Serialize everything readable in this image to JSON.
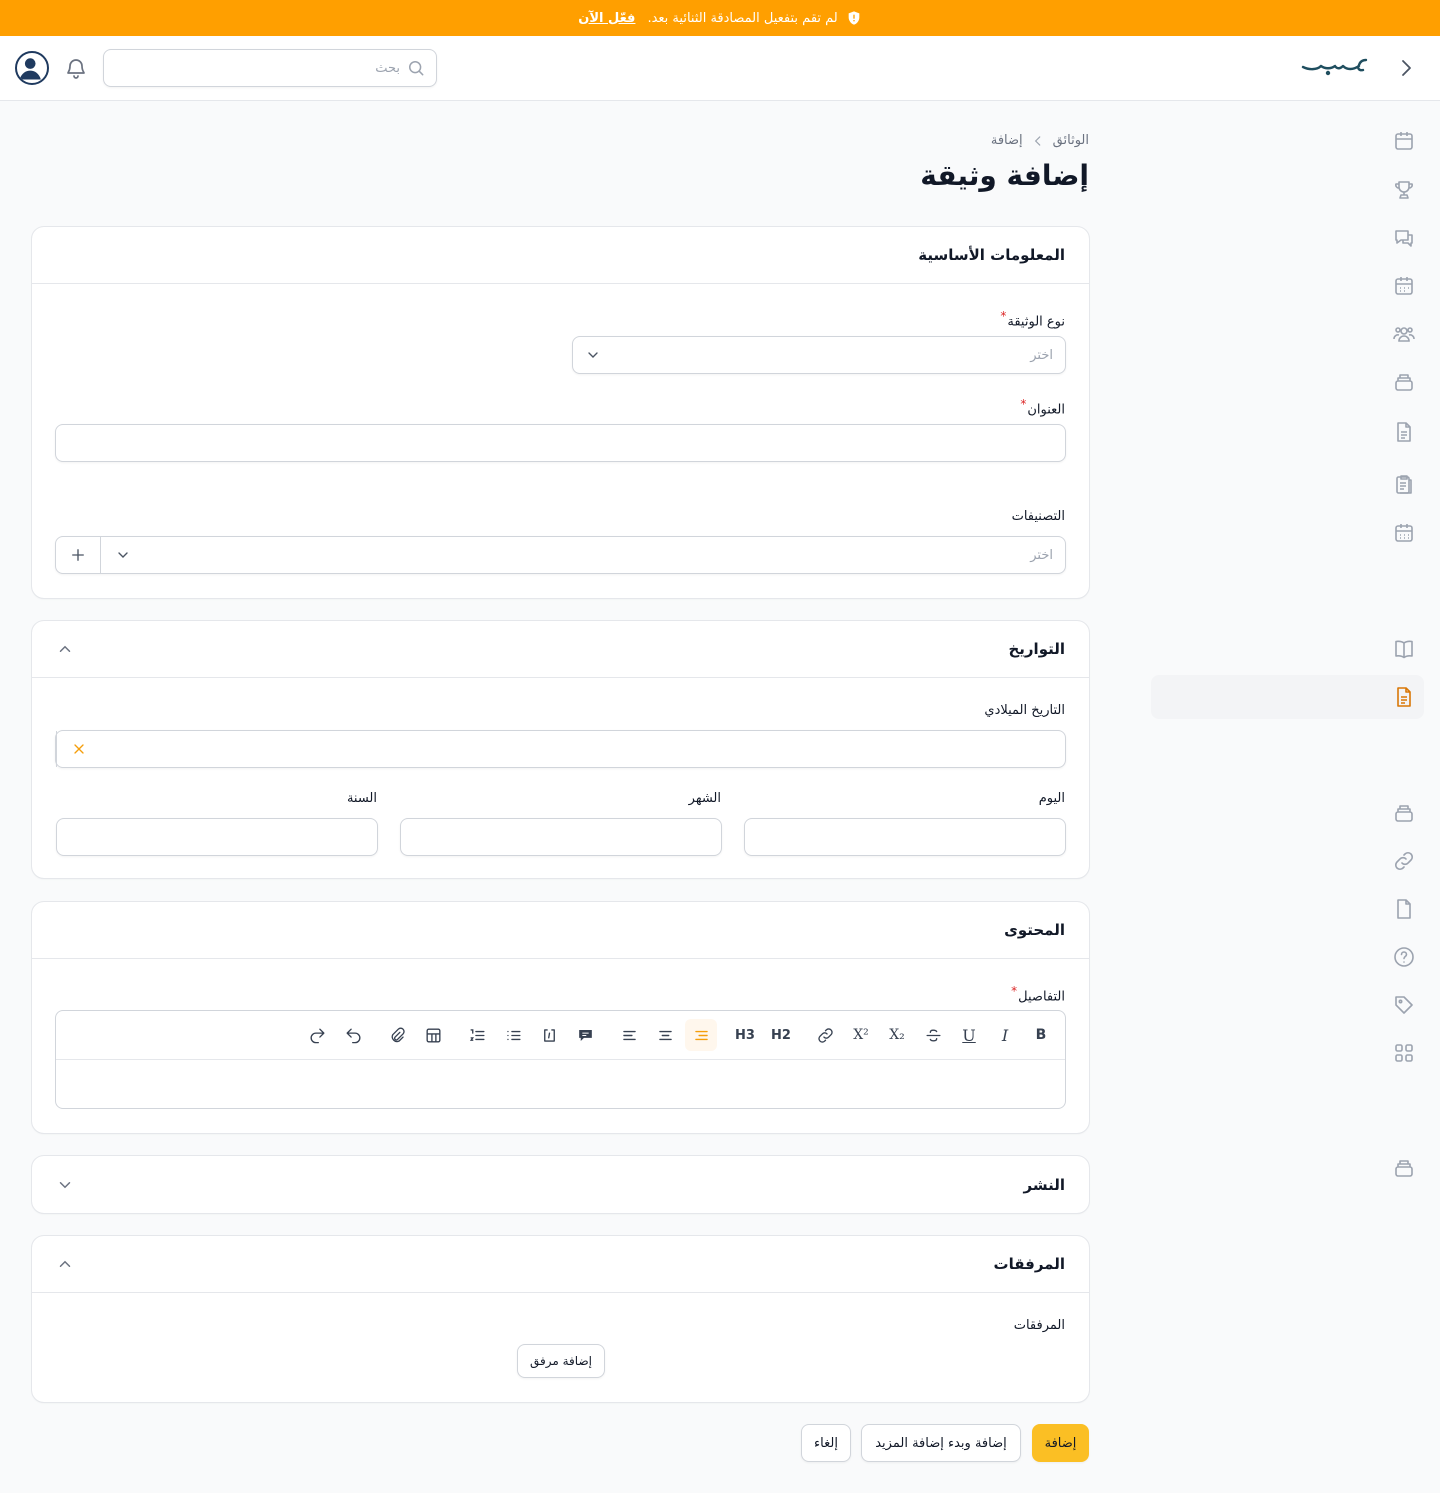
{
  "banner": {
    "message": "لم تقم بتفعيل المصادقة الثنائية بعد.",
    "action": "فعّل الآن"
  },
  "header": {
    "logo_text": "حسب",
    "search_placeholder": "بحث"
  },
  "breadcrumb": [
    "الوثائق",
    "إضافة"
  ],
  "page": {
    "title": "إضافة وثيقة"
  },
  "sections": {
    "basic": {
      "title": "المعلومات الأساسية",
      "doc_type_label": "نوع الوثيقة",
      "doc_type_placeholder": "اختر",
      "title_label": "العنوان",
      "title_value": "",
      "categories_label": "التصنيفات",
      "categories_placeholder": "اختر"
    },
    "dates": {
      "title": "التواريخ",
      "gregorian_label": "التاريخ الميلادي",
      "day_label": "اليوم",
      "month_label": "الشهر",
      "year_label": "السنة"
    },
    "content": {
      "title": "المحتوى",
      "details_label": "التفاصيل",
      "toolbar": {
        "bold": "B",
        "italic": "I",
        "underline": "U",
        "subscript": "X₂",
        "superscript": "X²",
        "h2": "H2",
        "h3": "H3"
      }
    },
    "publish": {
      "title": "النشر"
    },
    "attachments": {
      "title": "المرفقات",
      "field_label": "المرفقات",
      "add_button": "إضافة مرفق"
    }
  },
  "actions": {
    "create": "إضافة",
    "create_another": "إضافة وبدء إضافة المزيد",
    "cancel": "إلغاء"
  },
  "colors": {
    "banner": "#ff9f00",
    "primary": "#fbbf24",
    "active_icon": "#d97706"
  }
}
